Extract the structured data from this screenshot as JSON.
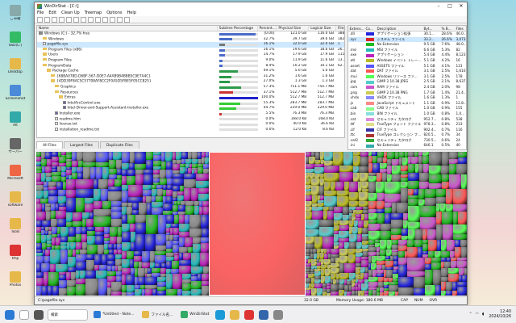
{
  "desktop": {
    "icons": [
      {
        "label": "ごみ箱",
        "color": "#8aa"
      },
      {
        "label": "SSD(C:)",
        "color": "#3b6"
      },
      {
        "label": "Desktop",
        "color": "#e6b84a"
      },
      {
        "label": "ScreenShot",
        "color": "#4a8ad6"
      },
      {
        "label": "Alt",
        "color": "#3aa"
      },
      {
        "label": "サーバー",
        "color": "#666"
      },
      {
        "label": "Microsoft",
        "color": "#e64"
      },
      {
        "label": "software",
        "color": "#e6b84a"
      },
      {
        "label": "Tools",
        "color": "#e6b84a"
      },
      {
        "label": "tmp",
        "color": "#d33"
      },
      {
        "label": "Photos",
        "color": "#e6b84a"
      }
    ]
  },
  "window": {
    "title": "WinDirStat - [C:\\]",
    "menu": [
      "File",
      "Edit",
      "Clean Up",
      "Treemap",
      "Options",
      "Help"
    ],
    "toolbar_icons": [
      "open",
      "save",
      "refresh",
      "stop",
      "copy",
      "delete",
      "explorer",
      "cmd",
      "props",
      "zoom-in",
      "zoom-out",
      "select",
      "help"
    ]
  },
  "tree": {
    "columns": [
      "Name",
      "Subtree Percentage",
      "Percent...",
      "Physical Size",
      "Logical Size",
      "Files"
    ],
    "rows": [
      {
        "name": "Windows (C:) - 32.7% free",
        "indent": 0,
        "icon": "drive",
        "pct": "[0.00]",
        "phys": "121.0 GB",
        "logi": "116.0 GB",
        "files": "388...",
        "fill": 0.95,
        "color": "#4a6cc8"
      },
      {
        "name": "Windows",
        "indent": 1,
        "icon": "folder",
        "pct": "32.7%",
        "phys": "39.7 GB",
        "logi": "39.6 GB",
        "files": "182...",
        "fill": 0.33,
        "color": "#4a6cc8"
      },
      {
        "name": "pagefile.sys",
        "indent": 1,
        "icon": "file",
        "pct": "16.1%",
        "phys": "32.0 GB",
        "logi": "32.0 GB",
        "files": "1",
        "fill": 0.16,
        "color": "#777",
        "selected": true
      },
      {
        "name": "Program Files (x86)",
        "indent": 1,
        "icon": "folder",
        "pct": "16.1%",
        "phys": "19.6 GB",
        "logi": "18.6 GB",
        "files": "26...",
        "fill": 0.16,
        "color": "#4a6cc8"
      },
      {
        "name": "Users",
        "indent": 1,
        "icon": "folder",
        "pct": "14.7%",
        "phys": "17.9 GB",
        "logi": "17.9 GB",
        "files": "115...",
        "fill": 0.15,
        "color": "#4a6cc8"
      },
      {
        "name": "Program Files",
        "indent": 1,
        "icon": "folder",
        "pct": "9.0%",
        "phys": "11.9 GB",
        "logi": "11.6 GB",
        "files": "13...",
        "fill": 0.09,
        "color": "#4a6cc8"
      },
      {
        "name": "ProgramData",
        "indent": 1,
        "icon": "folder",
        "pct": "8.4%",
        "phys": "10.2 GB",
        "logi": "10.1 GB",
        "files": "62...",
        "fill": 0.08,
        "color": "#4a6cc8"
      },
      {
        "name": "Package Cache",
        "indent": 2,
        "icon": "folder",
        "pct": "49.1%",
        "phys": "5.0 GB",
        "logi": "5.0 GB",
        "files": "",
        "fill": 0.49,
        "color": "#2c9a4a"
      },
      {
        "name": "{68BA078D-D6BF-567-D0E7-A4AB9B4BBB5C9E7A4C}",
        "indent": 3,
        "icon": "folder",
        "pct": "31.2%",
        "phys": "1.6 GB",
        "logi": "1.6 GB",
        "files": "",
        "fill": 0.31,
        "color": "#2c9a4a"
      },
      {
        "name": "{4DD39F8AC5C57708AF8CC2F0A5D5FBE5F05CC825}",
        "indent": 3,
        "icon": "folder",
        "pct": "27.0%",
        "phys": "1.3 GB",
        "logi": "1.3 GB",
        "files": "",
        "fill": 0.27,
        "color": "#2c9a4a"
      },
      {
        "name": "Graphics",
        "indent": 4,
        "icon": "folder",
        "pct": "57.3%",
        "phys": "751.1 MB",
        "logi": "750.7 MB",
        "files": "",
        "fill": 0.57,
        "color": "#2c9a4a"
      },
      {
        "name": "Resources",
        "indent": 4,
        "icon": "folder",
        "pct": "37.1%",
        "phys": "512.7 MB",
        "logi": "512.7 MB",
        "files": "",
        "fill": 0.37,
        "color": "#c33"
      },
      {
        "name": "Extras",
        "indent": 5,
        "icon": "folder",
        "pct": "100.0%",
        "phys": "512.7 MB",
        "logi": "512.7 MB",
        "files": "",
        "fill": 1.0,
        "color": "#22c"
      },
      {
        "name": "IntelArcControl.exe",
        "indent": 6,
        "icon": "exe",
        "pct": "55.3%",
        "phys": "283.7 MB",
        "logi": "283.7 MB",
        "files": "",
        "fill": 0.55,
        "color": "#3c3"
      },
      {
        "name": "Intel-Driver-and-Support-Assistant-Installer.exe",
        "indent": 6,
        "icon": "exe",
        "pct": "44.7%",
        "phys": "229.0 MB",
        "logi": "229.0 MB",
        "files": "",
        "fill": 0.45,
        "color": "#3c3"
      },
      {
        "name": "Installer.exe",
        "indent": 4,
        "icon": "exe",
        "pct": "5.5%",
        "phys": "76.3 MB",
        "logi": "76.3 MB",
        "files": "",
        "fill": 0.06,
        "color": "#c33"
      },
      {
        "name": "readme.htm",
        "indent": 4,
        "icon": "file",
        "pct": "0.0%",
        "phys": "168.0 KB",
        "logi": "168.0 KB",
        "files": "",
        "fill": 0.0,
        "color": "#c33"
      },
      {
        "name": "license.txt",
        "indent": 4,
        "icon": "file",
        "pct": "0.0%",
        "phys": "40.0 KB",
        "logi": "36.6 KB",
        "files": "",
        "fill": 0.0,
        "color": "#c33"
      },
      {
        "name": "installation_readme.txt",
        "indent": 4,
        "icon": "file",
        "pct": "0.0%",
        "phys": "12.0 KB",
        "logi": "8.6 KB",
        "files": "",
        "fill": 0.0,
        "color": "#c33"
      }
    ]
  },
  "extensions": {
    "columns": [
      "Extens...",
      "Co...",
      "Description",
      "Byt...",
      "% B...",
      "Files"
    ],
    "rows": [
      {
        "ext": ".dll",
        "color": "#2222dd",
        "desc": "アプリケーション拡張",
        "bytes": "30.1...",
        "pct": "28.6%",
        "files": "46.0..."
      },
      {
        "ext": ".sys",
        "color": "#dd2222",
        "desc": "システム ファイル",
        "bytes": "33.2...",
        "pct": "26.6%",
        "files": "3,073",
        "selected": true
      },
      {
        "ext": "",
        "color": "#22bb22",
        "desc": "No Extension",
        "bytes": "9.5 GB",
        "pct": "7.6%",
        "files": "48.0..."
      },
      {
        "ext": ".msi",
        "color": "#22bbbb",
        "desc": "MSI ファイル",
        "bytes": "6.6 GB",
        "pct": "5.3%",
        "files": "82"
      },
      {
        "ext": ".exe",
        "color": "#bb22bb",
        "desc": "アプリケーション",
        "bytes": "5.4 GB",
        "pct": "4.4%",
        "files": "8,123"
      },
      {
        "ext": ".etl",
        "color": "#bbbb22",
        "desc": "Windows イベント トレー...",
        "bytes": "5.1 GB",
        "pct": "4.2%",
        "files": "16"
      },
      {
        "ext": ".asset",
        "color": "#5555ff",
        "desc": "ASSETS ファイル",
        "bytes": "5.1 GB",
        "pct": "4.1%",
        "files": "131"
      },
      {
        "ext": ".dat",
        "color": "#ff5555",
        "desc": "DAT ファイル",
        "bytes": "3.1 GB",
        "pct": "2.5%",
        "files": "1,610"
      },
      {
        "ext": ".mui",
        "color": "#55ff55",
        "desc": "Windows リソース ファ...",
        "bytes": "3.1 GB",
        "pct": "2.5%",
        "files": "178"
      },
      {
        "ext": ".jpg",
        "color": "#55cccc",
        "desc": "GIMP 2.10.38 JPEG",
        "bytes": "2.5 GB",
        "pct": "2.1%",
        "files": "8,637"
      },
      {
        "ext": ".ram",
        "color": "#cc55cc",
        "desc": "RAM ファイル",
        "bytes": "2.4 GB",
        "pct": "2.0%",
        "files": "98"
      },
      {
        "ext": ".png",
        "color": "#cccc55",
        "desc": "GIMP 2.10.38 PNG",
        "bytes": "1.7 GB",
        "pct": "1.4%",
        "files": "21.4..."
      },
      {
        "ext": ".vhdx",
        "color": "#8888ff",
        "desc": "VHDX ファイル",
        "bytes": "1.6 GB",
        "pct": "1.3%",
        "files": "1"
      },
      {
        "ext": ".js",
        "color": "#ff8888",
        "desc": "JavaScript ドキュメント",
        "bytes": "1.1 GB",
        "pct": "0.9%",
        "files": "12.8..."
      },
      {
        "ext": ".cab",
        "color": "#88ff88",
        "desc": "CAB ファイル",
        "bytes": "1.0 GB",
        "pct": "0.9%",
        "files": "155"
      },
      {
        "ext": ".bin",
        "color": "#88dddd",
        "desc": "BIN ファイル",
        "bytes": "1.0 GB",
        "pct": "0.8%",
        "files": "1,0..."
      },
      {
        "ext": ".cat",
        "color": "#dd88dd",
        "desc": "セキュリティ カタログ",
        "bytes": "952.7...",
        "pct": "0.8%",
        "files": "538"
      },
      {
        "ext": ".ttf",
        "color": "#dddd88",
        "desc": "TrueType フォント ファイル",
        "bytes": "978.3...",
        "pct": "0.8%",
        "files": "233"
      },
      {
        "ext": ".cif",
        "color": "#3333aa",
        "desc": "CIF ファイル",
        "bytes": "902.4...",
        "pct": "0.7%",
        "files": "116"
      },
      {
        "ext": ".ttc",
        "color": "#aa3333",
        "desc": "TrueType コレクション フ...",
        "bytes": "820.5...",
        "pct": "0.7%",
        "files": "34"
      },
      {
        "ext": ".cat2",
        "color": "#33aa33",
        "desc": "セキュリティ カタログ",
        "bytes": "730.5...",
        "pct": "0.6%",
        "files": "24"
      },
      {
        "ext": ".ini",
        "color": "#33aaaa",
        "desc": "No Extension",
        "bytes": "646.1",
        "pct": "0.5%",
        "files": "40"
      }
    ]
  },
  "tabs": [
    "All Files",
    "Largest Files",
    "Duplicate Files"
  ],
  "status": {
    "path": "C:\\pagefile.sys",
    "size": "32.0 GB",
    "memory": "Memory Usage: 180.6 MB",
    "caps": "CAP",
    "num": "NUM",
    "ovr": "OVR"
  },
  "taskbar": {
    "search_placeholder": "検索",
    "tasks": [
      {
        "label": "*Untitled - Note...",
        "color": "#2a7ad6"
      },
      {
        "label": "ファイル名...",
        "color": "#e6b84a"
      },
      {
        "label": "WinDirStat",
        "color": "#3a6"
      }
    ],
    "time": "12:40",
    "date": "2024/10/26"
  }
}
